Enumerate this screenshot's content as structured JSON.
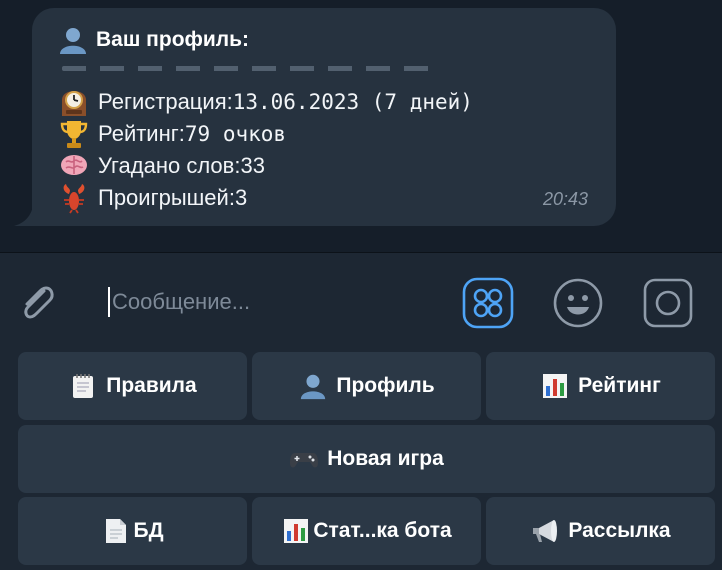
{
  "message": {
    "title": "Ваш профиль:",
    "title_icon": "bust-silhouette-icon",
    "lines": [
      {
        "icon": "mantelpiece-clock-icon",
        "label": "Регистрация: ",
        "value": "13.06.2023 (7 дней)"
      },
      {
        "icon": "trophy-icon",
        "label": "Рейтинг: ",
        "value": "79 очков"
      },
      {
        "icon": "brain-icon",
        "label": "Угадано слов: ",
        "value": "33"
      },
      {
        "icon": "lobster-icon",
        "label": "Проигрышей: ",
        "value": "3"
      }
    ],
    "time": "20:43"
  },
  "input": {
    "placeholder": "Сообщение..."
  },
  "keyboard": {
    "row1": [
      {
        "label": "Правила",
        "icon": "spiral-notepad-icon"
      },
      {
        "label": "Профиль",
        "icon": "bust-silhouette-icon"
      },
      {
        "label": "Рейтинг",
        "icon": "bar-chart-icon"
      }
    ],
    "row2": [
      {
        "label": "Новая игра",
        "icon": "video-game-icon"
      }
    ],
    "row3": [
      {
        "label": "БД",
        "icon": "page-facing-up-icon"
      },
      {
        "label": "Стат...ка бота",
        "icon": "bar-chart-icon"
      },
      {
        "label": "Рассылка",
        "icon": "loudspeaker-icon"
      }
    ]
  },
  "colors": {
    "background": "#151e29",
    "bubble": "#26323f",
    "panel": "#1d2733",
    "button": "#2b3846",
    "accent": "#4ea4f6",
    "muted": "#7e8a98"
  }
}
